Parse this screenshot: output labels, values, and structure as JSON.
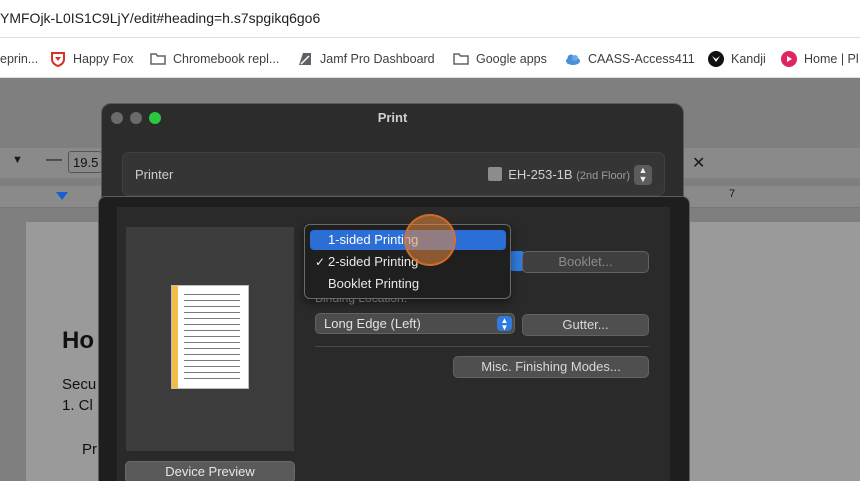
{
  "browser": {
    "url": "YMFOjk-L0IS1C9LjY/edit#heading=h.s7spgikq6go6",
    "bookmarks": [
      {
        "label": "eprin...",
        "icon": "doc-icon"
      },
      {
        "label": "Happy Fox",
        "icon": "happyfox-shield-icon"
      },
      {
        "label": "Chromebook repl...",
        "icon": "folder-icon"
      },
      {
        "label": "Jamf Pro Dashboard",
        "icon": "jamf-icon"
      },
      {
        "label": "Google apps",
        "icon": "folder-icon"
      },
      {
        "label": "CAASS-Access411",
        "icon": "cloud-icon"
      },
      {
        "label": "Kandji",
        "icon": "kandji-icon"
      },
      {
        "label": "Home | Pl",
        "icon": "home-app-icon"
      }
    ]
  },
  "docs": {
    "font_size": "19.5",
    "ruler_mark": "7",
    "heading_fragment": "Ho",
    "line1_fragment": "Secu",
    "line2_fragment": "1. Cl",
    "line3_fragment": "Pr"
  },
  "print_dialog": {
    "title": "Print",
    "printer_label": "Printer",
    "printer_name": "EH-253-1B",
    "printer_location": "(2nd Floor)",
    "booklet_button": "Booklet...",
    "binding_label": "Binding Location:",
    "binding_value": "Long Edge (Left)",
    "gutter_button": "Gutter...",
    "misc_button": "Misc. Finishing Modes...",
    "device_preview_button": "Device Preview",
    "menu": {
      "items": [
        "1-sided Printing",
        "2-sided Printing",
        "Booklet Printing"
      ],
      "highlighted": "1-sided Printing",
      "checked": "2-sided Printing"
    }
  },
  "colors": {
    "menu_highlight": "#2b6fd6",
    "booklet_bar": "#f4bb4a",
    "cursor_ring": "#e6873c"
  }
}
